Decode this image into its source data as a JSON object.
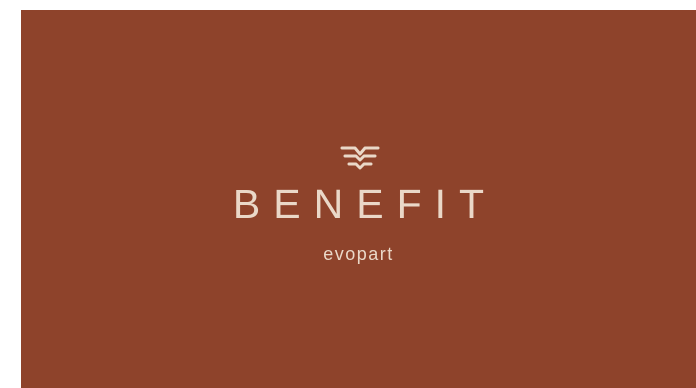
{
  "logo": {
    "icon": "wave-emblem-icon",
    "brand_name": "BENEFIT",
    "sub_brand": "evopart"
  },
  "colors": {
    "background": "#8e432b",
    "foreground": "#ead8c8",
    "page": "#ffffff"
  }
}
